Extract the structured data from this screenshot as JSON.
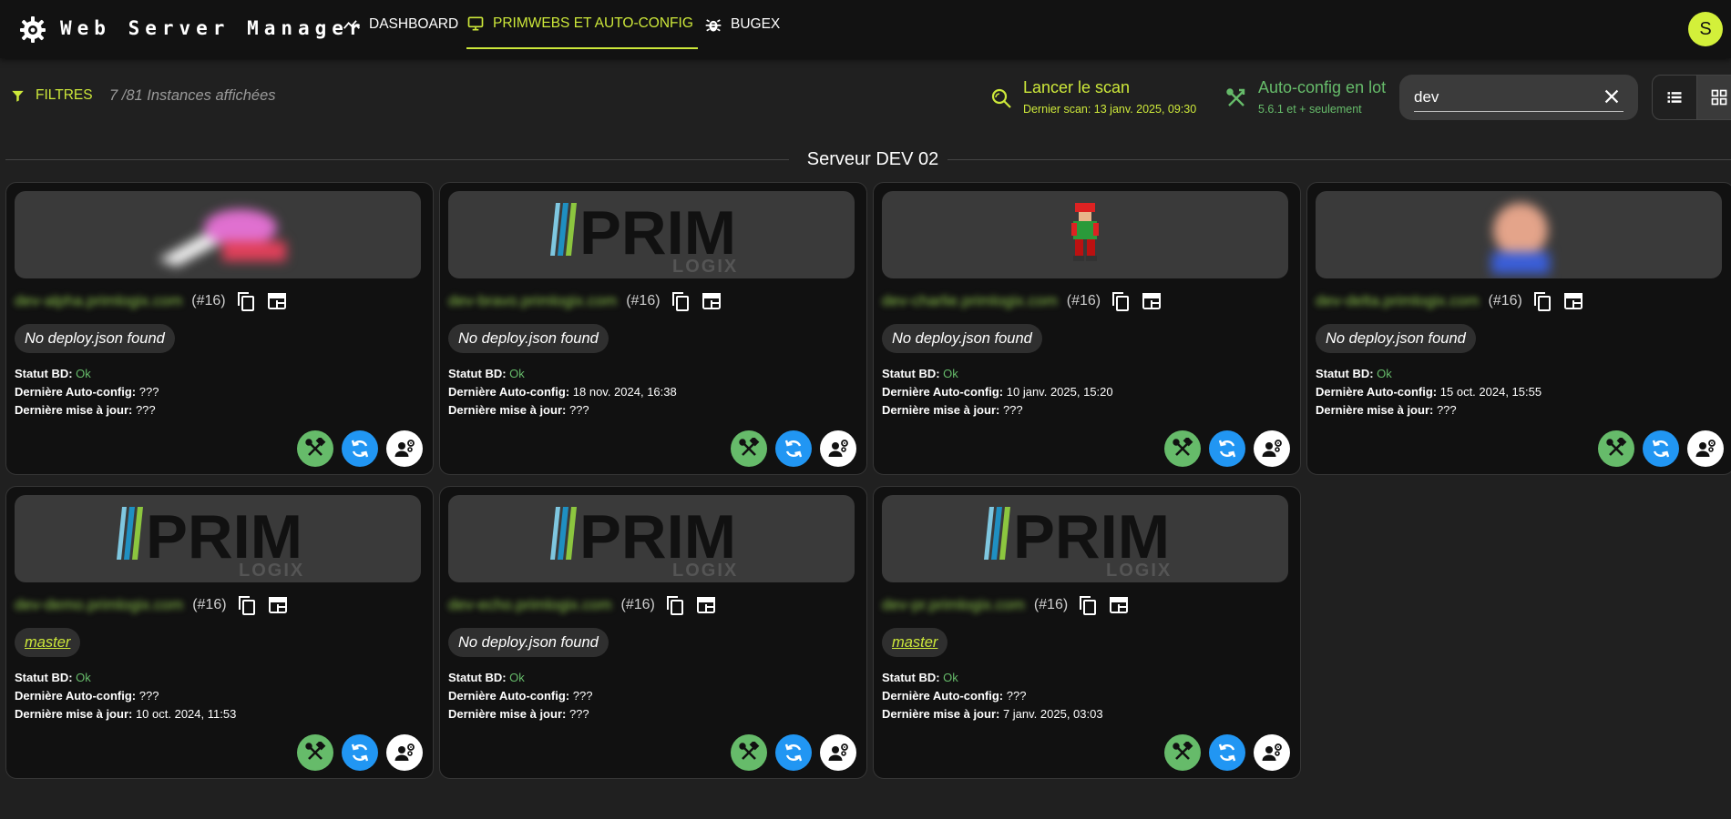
{
  "app": {
    "title": "Web Server Manager",
    "avatar_initial": "S",
    "accent_color": "#cde83a"
  },
  "nav": {
    "tabs": [
      {
        "label": "DASHBOARD",
        "icon": "trending-icon",
        "active": false
      },
      {
        "label": "PRIMWEBS ET AUTO-CONFIG",
        "icon": "monitor-icon",
        "active": true
      },
      {
        "label": "BUGEX",
        "icon": "bug-icon",
        "active": false
      }
    ]
  },
  "toolbar": {
    "filters_label": "FILTRES",
    "count_label": "7 /81 Instances affichées",
    "scan_title": "Lancer le scan",
    "scan_subtitle": "Dernier scan: 13 janv. 2025, 09:30",
    "autoconfig_title": "Auto-config en lot",
    "autoconfig_subtitle": "5.6.1 et + seulement",
    "search_value": "dev",
    "view_mode": "grid"
  },
  "section": {
    "title": "Serveur DEV 02"
  },
  "labels": {
    "db_status": "Statut BD:",
    "last_autoconfig": "Dernière Auto-config:",
    "last_update": "Dernière mise à jour:"
  },
  "logo": {
    "prim": "PRIM",
    "logix": "LOGIX"
  },
  "cards": [
    {
      "domain": "dev-alpha.primlogix.com",
      "num": "(#16)",
      "deploy": "No deploy.json found",
      "deploy_is_branch": false,
      "db_status": "Ok",
      "last_autoconfig": "???",
      "last_update": "???",
      "banner": "blur-pink"
    },
    {
      "domain": "dev-bravo.primlogix.com",
      "num": "(#16)",
      "deploy": "No deploy.json found",
      "deploy_is_branch": false,
      "db_status": "Ok",
      "last_autoconfig": "18 nov. 2024, 16:38",
      "last_update": "???",
      "banner": "primlogix"
    },
    {
      "domain": "dev-charlie.primlogix.com",
      "num": "(#16)",
      "deploy": "No deploy.json found",
      "deploy_is_branch": false,
      "db_status": "Ok",
      "last_autoconfig": "10 janv. 2025, 15:20",
      "last_update": "???",
      "banner": "pixel-character"
    },
    {
      "domain": "dev-delta.primlogix.com",
      "num": "(#16)",
      "deploy": "No deploy.json found",
      "deploy_is_branch": false,
      "db_status": "Ok",
      "last_autoconfig": "15 oct. 2024, 15:55",
      "last_update": "???",
      "banner": "blur-face"
    },
    {
      "domain": "dev-demo.primlogix.com",
      "num": "(#16)",
      "deploy": "master",
      "deploy_is_branch": true,
      "db_status": "Ok",
      "last_autoconfig": "???",
      "last_update": "10 oct. 2024, 11:53",
      "banner": "primlogix"
    },
    {
      "domain": "dev-echo.primlogix.com",
      "num": "(#16)",
      "deploy": "No deploy.json found",
      "deploy_is_branch": false,
      "db_status": "Ok",
      "last_autoconfig": "???",
      "last_update": "???",
      "banner": "primlogix"
    },
    {
      "domain": "dev-pr.primlogix.com",
      "num": "(#16)",
      "deploy": "master",
      "deploy_is_branch": true,
      "db_status": "Ok",
      "last_autoconfig": "???",
      "last_update": "7 janv. 2025, 03:03",
      "banner": "primlogix"
    }
  ],
  "colors": {
    "ok": "#66bb6a",
    "autoconfig_button": "#66bb6a",
    "refresh_button": "#2196f3",
    "user_button": "#ffffff",
    "domain": "#8bc34a"
  }
}
